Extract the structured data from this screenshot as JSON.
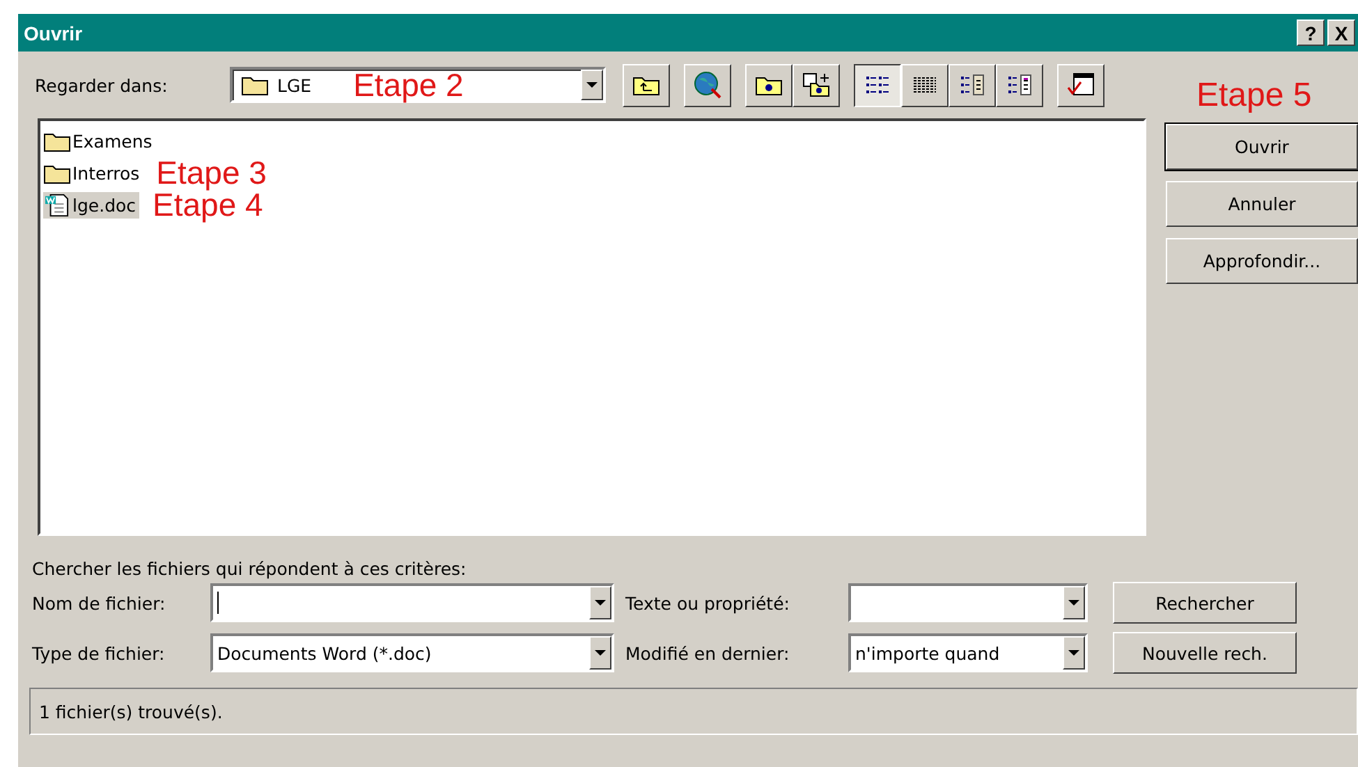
{
  "window": {
    "title": "Ouvrir",
    "controls": [
      "?",
      "X"
    ]
  },
  "look_in": {
    "label": "Regarder dans:",
    "value": "LGE",
    "annotation": "Etape 2"
  },
  "toolbar": [
    {
      "kind": "up"
    },
    {
      "kind": "web"
    },
    {
      "kind": "newfolder"
    },
    {
      "kind": "favorite"
    },
    {
      "kind": "listview",
      "selected": true
    },
    {
      "kind": "detailsview",
      "selected": false
    },
    {
      "kind": "propertiesview",
      "selected": false
    },
    {
      "kind": "previewview",
      "selected": false
    },
    {
      "kind": "tools"
    }
  ],
  "side_annotation": "Etape 5",
  "files": [
    {
      "kind": "folder",
      "name": "Examens",
      "selected": false
    },
    {
      "kind": "folder",
      "name": "Interros",
      "selected": false,
      "annotation": "Etape 3"
    },
    {
      "kind": "doc",
      "name": "lge.doc",
      "selected": true,
      "annotation": "Etape 4"
    }
  ],
  "buttons": [
    {
      "label": "Ouvrir",
      "default": true
    },
    {
      "label": "Annuler",
      "default": false
    },
    {
      "label": "Approfondir...",
      "default": false
    }
  ],
  "search": {
    "heading": "Chercher les fichiers qui répondent à ces critères:",
    "fields": [
      {
        "label": "Nom de fichier:",
        "cursor": true
      },
      {
        "label": "Texte ou propriété:",
        "cursor": false
      },
      {
        "label": "Type de fichier:",
        "value": "Documents Word (*.doc)",
        "cursor": false
      },
      {
        "label": "Modifié en dernier:",
        "value": "n'importe quand",
        "cursor": false
      }
    ],
    "buttons": [
      "Rechercher",
      "Nouvelle rech."
    ]
  },
  "status_bar": "1 fichier(s) trouvé(s)."
}
